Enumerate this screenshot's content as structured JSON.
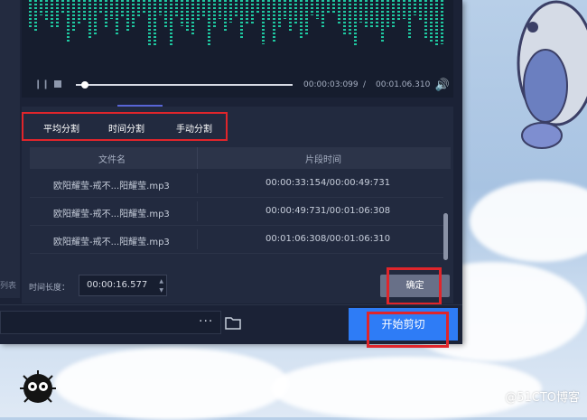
{
  "player": {
    "pause_icon": "pause-icon",
    "stop_icon": "stop-icon",
    "current_time": "00:00:03:099",
    "separator": "/",
    "total_time": "00:01.06.310",
    "volume_icon": "volume-icon"
  },
  "tabs": [
    {
      "label": "平均分割"
    },
    {
      "label": "时间分割"
    },
    {
      "label": "手动分割"
    }
  ],
  "table": {
    "headers": [
      "文件名",
      "片段时间"
    ],
    "rows": [
      {
        "file": "欧阳耀莹-戒不...阳耀莹.mp3",
        "segment": "00:00:33:154/00:00:49:731"
      },
      {
        "file": "欧阳耀莹-戒不...阳耀莹.mp3",
        "segment": "00:00:49:731/00:01:06:308"
      },
      {
        "file": "欧阳耀莹-戒不...阳耀莹.mp3",
        "segment": "00:01:06:308/00:01:06:310"
      }
    ]
  },
  "sidebar": {
    "partial_label": "列表"
  },
  "duration": {
    "label": "时间长度：",
    "value": "00:00:16.577"
  },
  "buttons": {
    "confirm": "确定",
    "start_cut": "开始剪切",
    "more": "···"
  },
  "watermark": "@51CTO博客",
  "colors": {
    "accent": "#2e7cf6",
    "highlight": "#e0252b",
    "waveform": "#1fc7a0"
  }
}
